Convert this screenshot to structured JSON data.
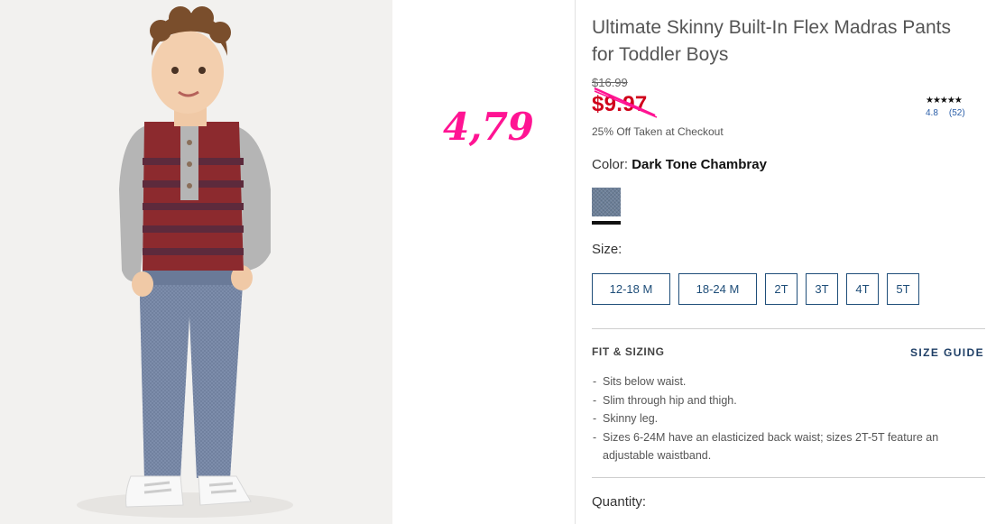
{
  "overlay": {
    "handwritten_price": "4,79"
  },
  "product": {
    "title": "Ultimate Skinny Built-In Flex Madras Pants for Toddler Boys",
    "original_price": "$16.99",
    "sale_price": "$9.97",
    "promo_text": "25% Off Taken at Checkout",
    "rating": {
      "stars": 4.8,
      "star_glyphs": "★★★★★",
      "score": "4.8",
      "review_count": "(52)"
    },
    "color": {
      "label": "Color:",
      "value": "Dark Tone Chambray",
      "swatch_color": "#6c7f98"
    },
    "size": {
      "label": "Size:",
      "options": [
        "12-18 M",
        "18-24 M",
        "2T",
        "3T",
        "4T",
        "5T"
      ]
    },
    "fit": {
      "heading": "FIT & SIZING",
      "size_guide_label": "SIZE GUIDE",
      "bullets": [
        "Sits below waist.",
        "Slim through hip and thigh.",
        "Skinny leg.",
        "Sizes 6-24M have an elasticized back waist; sizes 2T-5T feature an adjustable waistband."
      ]
    },
    "quantity_label": "Quantity:"
  },
  "colors": {
    "sale_red": "#d0021b",
    "link_blue": "#1f4e79",
    "overlay_pink": "#ff1493"
  },
  "icons": {
    "rating": "star-icon",
    "strike": "strike-line"
  }
}
